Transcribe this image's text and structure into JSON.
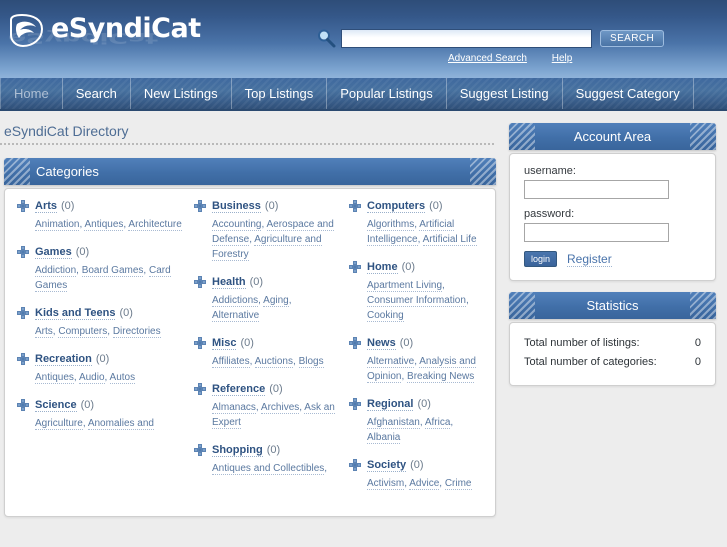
{
  "header": {
    "logo_text": "eSyndiCat",
    "logo_icon": "leaf-mark-icon",
    "search": {
      "icon": "magnifier-icon",
      "value": "",
      "placeholder": "",
      "button_label": "SEARCH",
      "advanced_label": "Advanced Search",
      "help_label": "Help"
    }
  },
  "nav": {
    "items": [
      {
        "label": "Home",
        "active": true
      },
      {
        "label": "Search",
        "active": false
      },
      {
        "label": "New Listings",
        "active": false
      },
      {
        "label": "Top Listings",
        "active": false
      },
      {
        "label": "Popular Listings",
        "active": false
      },
      {
        "label": "Suggest Listing",
        "active": false
      },
      {
        "label": "Suggest Category",
        "active": false
      }
    ]
  },
  "main": {
    "page_title": "eSyndiCat Directory",
    "categories_panel_title": "Categories",
    "columns": [
      [
        {
          "name": "Arts",
          "count": "(0)",
          "subs": [
            "Animation",
            "Antiques",
            "Architecture"
          ]
        },
        {
          "name": "Games",
          "count": "(0)",
          "subs": [
            "Addiction",
            "Board Games",
            "Card Games"
          ]
        },
        {
          "name": "Kids and Teens",
          "count": "(0)",
          "subs": [
            "Arts",
            "Computers",
            "Directories"
          ]
        },
        {
          "name": "Recreation",
          "count": "(0)",
          "subs": [
            "Antiques",
            "Audio",
            "Autos"
          ]
        },
        {
          "name": "Science",
          "count": "(0)",
          "subs": [
            "Agriculture",
            "Anomalies and"
          ]
        }
      ],
      [
        {
          "name": "Business",
          "count": "(0)",
          "subs": [
            "Accounting",
            "Aerospace and Defense",
            "Agriculture and Forestry"
          ]
        },
        {
          "name": "Health",
          "count": "(0)",
          "subs": [
            "Addictions",
            "Aging",
            "Alternative"
          ]
        },
        {
          "name": "Misc",
          "count": "(0)",
          "subs": [
            "Affiliates",
            "Auctions",
            "Blogs"
          ]
        },
        {
          "name": "Reference",
          "count": "(0)",
          "subs": [
            "Almanacs",
            "Archives",
            "Ask an Expert"
          ]
        },
        {
          "name": "Shopping",
          "count": "(0)",
          "subs": [
            "Antiques and Collectibles",
            ""
          ]
        }
      ],
      [
        {
          "name": "Computers",
          "count": "(0)",
          "subs": [
            "Algorithms",
            "Artificial Intelligence",
            "Artificial Life"
          ]
        },
        {
          "name": "Home",
          "count": "(0)",
          "subs": [
            "Apartment Living",
            "Consumer Information",
            "Cooking"
          ]
        },
        {
          "name": "News",
          "count": "(0)",
          "subs": [
            "Alternative",
            "Analysis and Opinion",
            "Breaking News"
          ]
        },
        {
          "name": "Regional",
          "count": "(0)",
          "subs": [
            "Afghanistan",
            "Africa",
            "Albania"
          ]
        },
        {
          "name": "Society",
          "count": "(0)",
          "subs": [
            "Activism",
            "Advice",
            "Crime"
          ]
        }
      ]
    ]
  },
  "sidebar": {
    "account": {
      "title": "Account Area",
      "username_label": "username:",
      "username_value": "",
      "password_label": "password:",
      "password_value": "",
      "login_label": "login",
      "register_label": "Register"
    },
    "statistics": {
      "title": "Statistics",
      "rows": [
        {
          "label": "Total number of listings:",
          "value": "0"
        },
        {
          "label": "Total number of categories:",
          "value": "0"
        }
      ]
    }
  },
  "colors": {
    "header_top": "#2e4d78",
    "header_bottom": "#8fb3da",
    "nav_bg": "#3f699f",
    "panel_head": "#416fa8",
    "link": "#5b79a0",
    "cat_name": "#2f5382",
    "page_bg": "#ededed"
  }
}
